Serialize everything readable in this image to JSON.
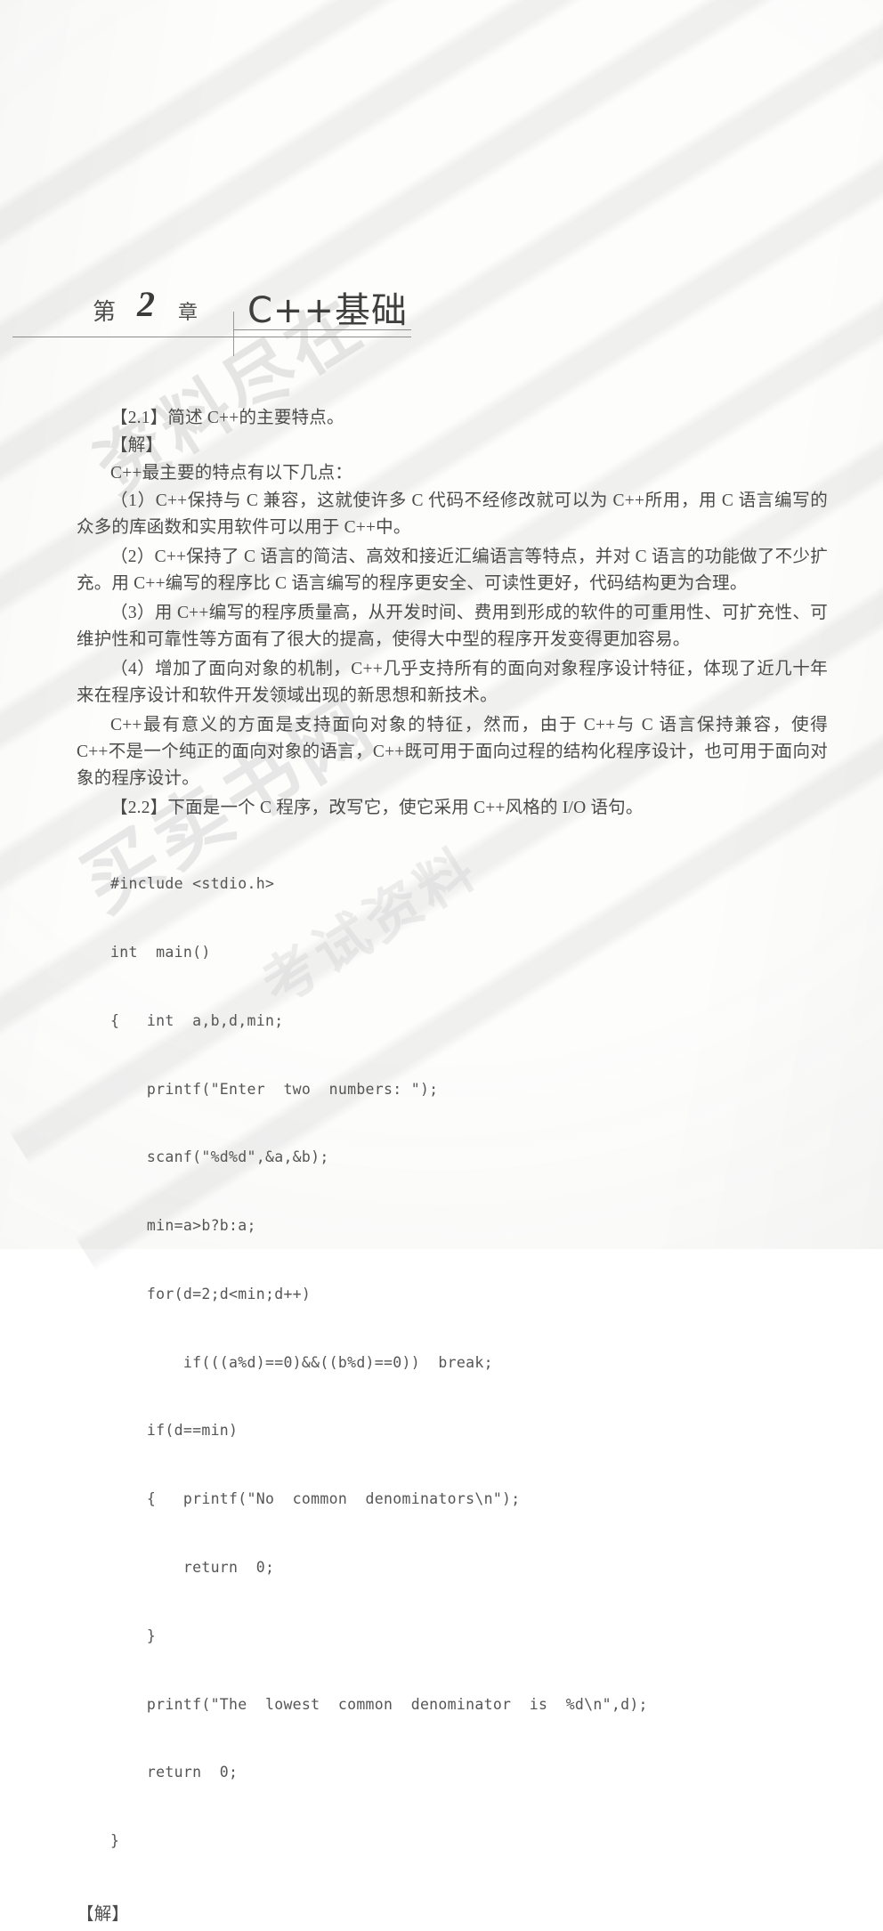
{
  "page": {
    "background_color": "#fdfdfc",
    "text_color": "#4b4b4b"
  },
  "chapter_header": {
    "label_prefix": "第",
    "number": "2",
    "label_suffix": "章",
    "title": "C++基础"
  },
  "watermark": {
    "line1": "资料尽在",
    "line2": "买卖书网",
    "line3": "考试资料"
  },
  "content": {
    "q21_title": "【2.1】简述 C++的主要特点。",
    "q21_solution_marker": "【解】",
    "q21_lead": "C++最主要的特点有以下几点：",
    "q21_points": [
      "（1）C++保持与 C 兼容，这就使许多 C 代码不经修改就可以为 C++所用，用 C 语言编写的众多的库函数和实用软件可以用于 C++中。",
      "（2）C++保持了 C 语言的简洁、高效和接近汇编语言等特点，并对 C 语言的功能做了不少扩充。用 C++编写的程序比 C 语言编写的程序更安全、可读性更好，代码结构更为合理。",
      "（3）用 C++编写的程序质量高，从开发时间、费用到形成的软件的可重用性、可扩充性、可维护性和可靠性等方面有了很大的提高，使得大中型的程序开发变得更加容易。",
      "（4）增加了面向对象的机制，C++几乎支持所有的面向对象程序设计特征，体现了近几十年来在程序设计和软件开发领域出现的新思想和新技术。"
    ],
    "q21_closing": "C++最有意义的方面是支持面向对象的特征，然而，由于 C++与 C 语言保持兼容，使得 C++不是一个纯正的面向对象的语言，C++既可用于面向过程的结构化程序设计，也可用于面向对象的程序设计。",
    "q22_title": "【2.2】下面是一个 C 程序，改写它，使它采用 C++风格的 I/O 语句。",
    "q22_code": [
      "#include <stdio.h>",
      "int  main()",
      "{   int  a,b,d,min;",
      "    printf(\"Enter  two  numbers: \");",
      "    scanf(\"%d%d\",&a,&b);",
      "    min=a>b?b:a;",
      "    for(d=2;d<min;d++)",
      "        if(((a%d)==0)&&((b%d)==0))  break;",
      "    if(d==min)",
      "    {   printf(\"No  common  denominators\\n\");",
      "        return  0;",
      "    }",
      "    printf(\"The  lowest  common  denominator  is  %d\\n\",d);",
      "    return  0;",
      "}"
    ],
    "q22_solution_marker": "【解】"
  }
}
